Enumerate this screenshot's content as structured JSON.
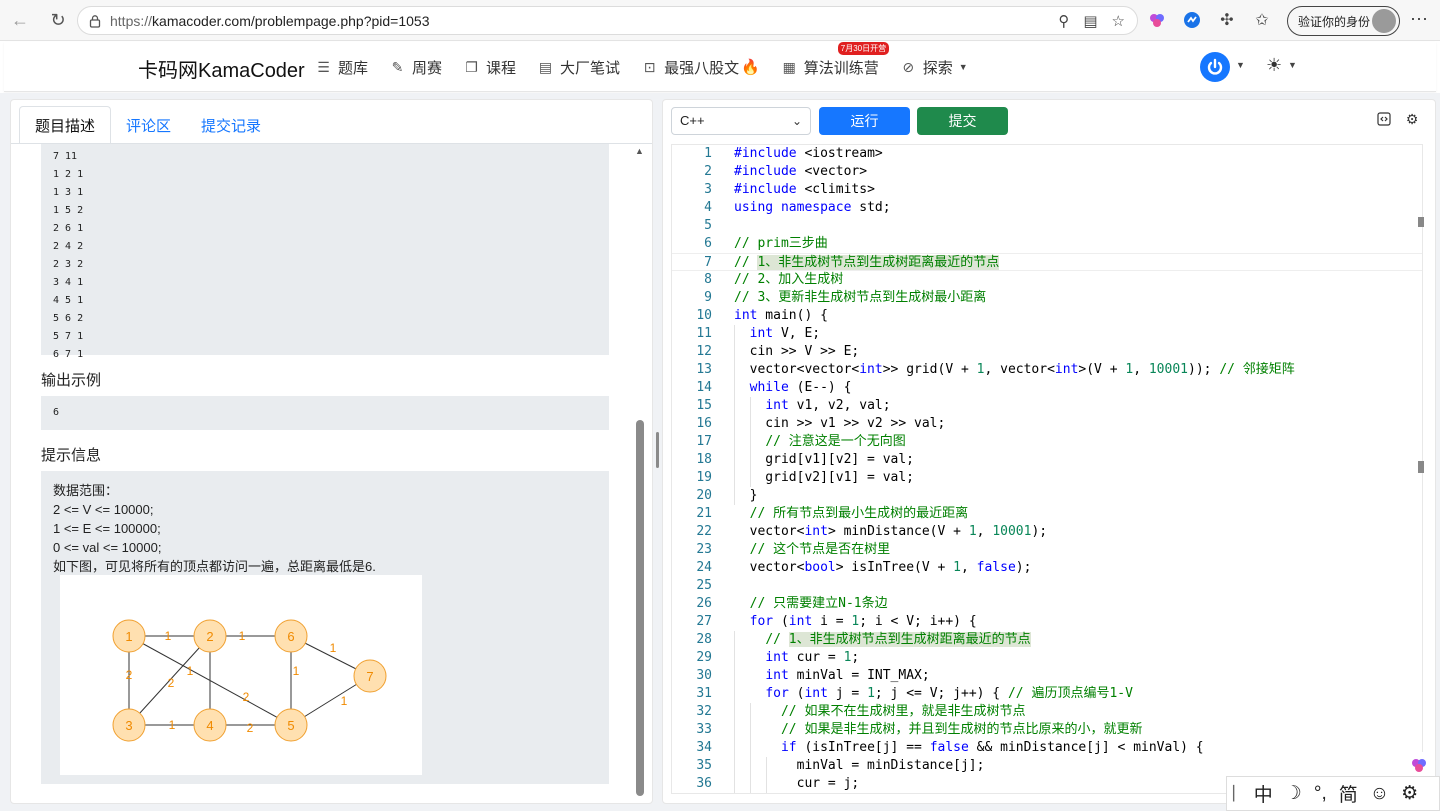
{
  "browser": {
    "url_scheme": "https://",
    "url_rest": "kamacoder.com/problempage.php?pid=1053",
    "profile_label": "验证你的身份"
  },
  "site": {
    "brand": "卡码网KamaCoder",
    "nav": [
      {
        "label": "题库",
        "icon": "list-icon"
      },
      {
        "label": "周赛",
        "icon": "pencil-icon"
      },
      {
        "label": "课程",
        "icon": "copy-icon"
      },
      {
        "label": "大厂笔试",
        "icon": "document-icon"
      },
      {
        "label": "最强八股文",
        "icon": "code-file-icon"
      },
      {
        "label": "算法训练营",
        "icon": "calendar-icon",
        "badge": "7月30日开营"
      },
      {
        "label": "探索",
        "icon": "compass-icon"
      }
    ],
    "accent": "#1677ff"
  },
  "left": {
    "tabs": [
      "题目描述",
      "评论区",
      "提交记录"
    ],
    "input_lines": [
      "7 11",
      "1 2 1",
      "1 3 1",
      "1 5 2",
      "2 6 1",
      "2 4 2",
      "2 3 2",
      "3 4 1",
      "4 5 1",
      "5 6 2",
      "5 7 1",
      "6 7 1"
    ],
    "output_title": "输出示例",
    "output_value": "6",
    "hint_title": "提示信息",
    "hint_lines": [
      "数据范围：",
      "2 <= V <= 10000;",
      "1 <= E <= 100000;",
      "0 <= val <= 10000;",
      "如下图，可见将所有的顶点都访问一遍，总距离最低是6."
    ],
    "graph": {
      "nodes": [
        "1",
        "2",
        "6",
        "7",
        "3",
        "4",
        "5"
      ],
      "edge_labels": [
        "1",
        "1",
        "1",
        "2",
        "2",
        "2",
        "1",
        "1",
        "2",
        "1",
        "1"
      ],
      "node_color": "#ffe0b0",
      "edge_label_color": "#f08a00"
    }
  },
  "right": {
    "language": "C++",
    "run_label": "运行",
    "submit_label": "提交",
    "code": [
      "#include <iostream>",
      "#include <vector>",
      "#include <climits>",
      "using namespace std;",
      "",
      "// prim三步曲",
      "// 1、非生成树节点到生成树距离最近的节点",
      "// 2、加入生成树",
      "// 3、更新非生成树节点到生成树最小距离",
      "int main() {",
      "  int V, E;",
      "  cin >> V >> E;",
      "  vector<vector<int>> grid(V + 1, vector<int>(V + 1, 10001)); // 邻接矩阵",
      "  while (E--) {",
      "    int v1, v2, val;",
      "    cin >> v1 >> v2 >> val;",
      "    // 注意这是一个无向图",
      "    grid[v1][v2] = val;",
      "    grid[v2][v1] = val;",
      "  }",
      "  // 所有节点到最小生成树的最近距离",
      "  vector<int> minDistance(V + 1, 10001);",
      "  // 这个节点是否在树里",
      "  vector<bool> isInTree(V + 1, false);",
      "",
      "  // 只需要建立N-1条边",
      "  for (int i = 1; i < V; i++) {",
      "    // 1、非生成树节点到生成树距离最近的节点",
      "    int cur = 1;",
      "    int minVal = INT_MAX;",
      "    for (int j = 1; j <= V; j++) { // 遍历顶点编号1-V",
      "      // 如果不在生成树里，就是非生成树节点",
      "      // 如果是非生成树，并且到生成树的节点比原来的小，就更新",
      "      if (isInTree[j] == false && minDistance[j] < minVal) {",
      "        minVal = minDistance[j];",
      "        cur = j;"
    ],
    "current_line": 7
  },
  "ime": [
    "中",
    "☽",
    "°,",
    "简",
    "☺",
    "⚙"
  ]
}
